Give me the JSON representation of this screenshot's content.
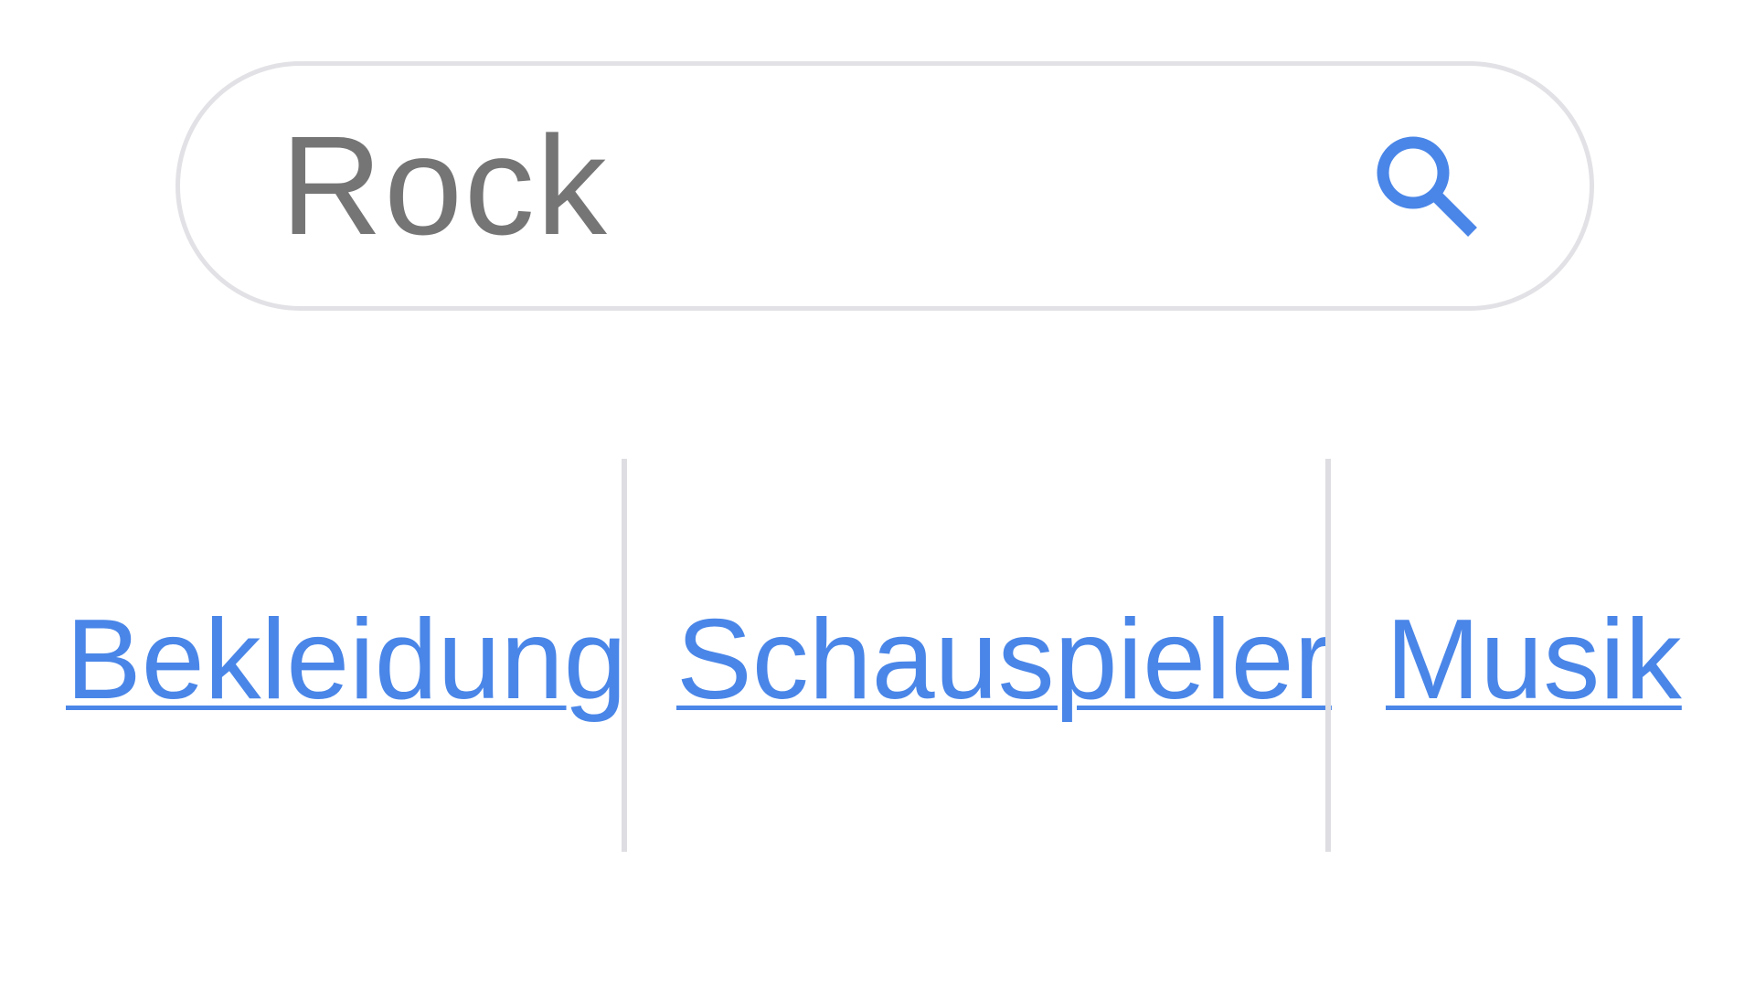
{
  "search": {
    "value": "Rock",
    "icon": "search-icon"
  },
  "suggestions": [
    {
      "label": "Bekleidung"
    },
    {
      "label": "Schauspieler"
    },
    {
      "label": "Musik"
    }
  ],
  "colors": {
    "accent": "#4a86e8",
    "input_text": "#757575",
    "border": "#e2e2e6",
    "divider": "#dddde2"
  }
}
